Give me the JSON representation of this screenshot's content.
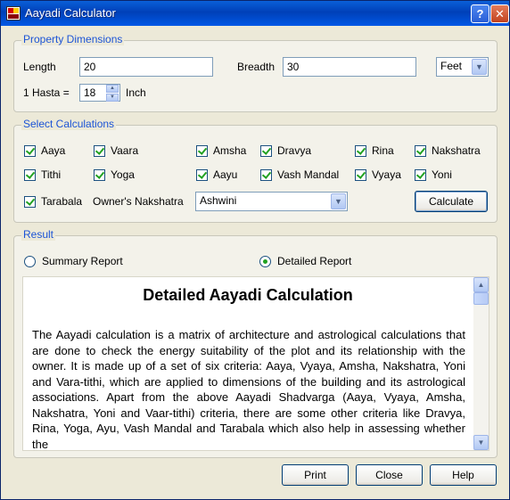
{
  "window": {
    "title": "Aayadi Calculator",
    "help_glyph": "?",
    "close_glyph": "✕"
  },
  "property": {
    "legend": "Property Dimensions",
    "length_label": "Length",
    "length_value": "20",
    "breadth_label": "Breadth",
    "breadth_value": "30",
    "unit_value": "Feet",
    "hasta_label": "1 Hasta =",
    "hasta_value": "18",
    "hasta_unit": "Inch"
  },
  "calculations": {
    "legend": "Select Calculations",
    "items": [
      {
        "label": "Aaya",
        "checked": true
      },
      {
        "label": "Vaara",
        "checked": true
      },
      {
        "label": "Amsha",
        "checked": true
      },
      {
        "label": "Dravya",
        "checked": true
      },
      {
        "label": "Rina",
        "checked": true
      },
      {
        "label": "Nakshatra",
        "checked": true
      },
      {
        "label": "Tithi",
        "checked": true
      },
      {
        "label": "Yoga",
        "checked": true
      },
      {
        "label": "Aayu",
        "checked": true
      },
      {
        "label": "Vash Mandal",
        "checked": true
      },
      {
        "label": "Vyaya",
        "checked": true
      },
      {
        "label": "Yoni",
        "checked": true
      },
      {
        "label": "Tarabala",
        "checked": true
      }
    ],
    "owner_label": "Owner's Nakshatra",
    "owner_value": "Ashwini",
    "calculate_label": "Calculate"
  },
  "result": {
    "legend": "Result",
    "summary_label": "Summary Report",
    "detailed_label": "Detailed Report",
    "selected": "Detailed Report",
    "report_title": "Detailed Aayadi Calculation",
    "report_text": "The Aayadi calculation is a matrix of architecture and astrological calculations that are done to check the energy suitability of the plot and its relationship with the owner. It is made up of a set of six criteria: Aaya, Vyaya, Amsha, Nakshatra, Yoni and Vara-tithi, which are applied to dimensions of the building and its astrological associations. Apart from the above Aayadi Shadvarga (Aaya, Vyaya, Amsha, Nakshatra, Yoni and Vaar-tithi) criteria, there are some other criteria like Dravya, Rina, Yoga, Ayu, Vash Mandal and Tarabala which also help in assessing whether the"
  },
  "footer": {
    "print_label": "Print",
    "close_label": "Close",
    "help_label": "Help"
  },
  "icons": {
    "dropdown": "chevron-down-icon",
    "spin_up": "arrow-up-icon",
    "spin_down": "arrow-down-icon"
  },
  "colors": {
    "titlebar": "#0054e3",
    "legend_text": "#1c54d6",
    "check": "#21a121",
    "dialog_bg": "#ece9d8"
  }
}
